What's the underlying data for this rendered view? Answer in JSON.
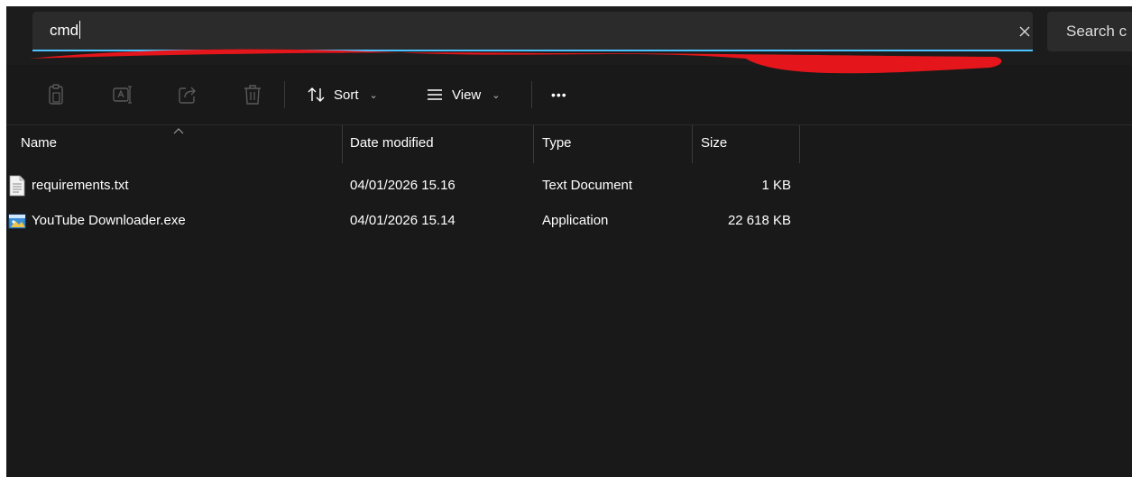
{
  "address_bar": {
    "value": "cmd"
  },
  "search": {
    "placeholder": "Search c"
  },
  "command_bar": {
    "sort_label": "Sort",
    "view_label": "View",
    "more_label": "•••"
  },
  "columns": {
    "name": "Name",
    "date_modified": "Date modified",
    "type": "Type",
    "size": "Size"
  },
  "files": [
    {
      "name": "requirements.txt",
      "date": "04/01/2026 15.16",
      "type": "Text Document",
      "size": "1 KB",
      "icon": "text-file-icon"
    },
    {
      "name": "YouTube Downloader.exe",
      "date": "04/01/2026 15.14",
      "type": "Application",
      "size": "22 618 KB",
      "icon": "application-icon"
    }
  ],
  "colors": {
    "background": "#191919",
    "accent": "#4cc2ff",
    "scribble": "#e4161b"
  }
}
